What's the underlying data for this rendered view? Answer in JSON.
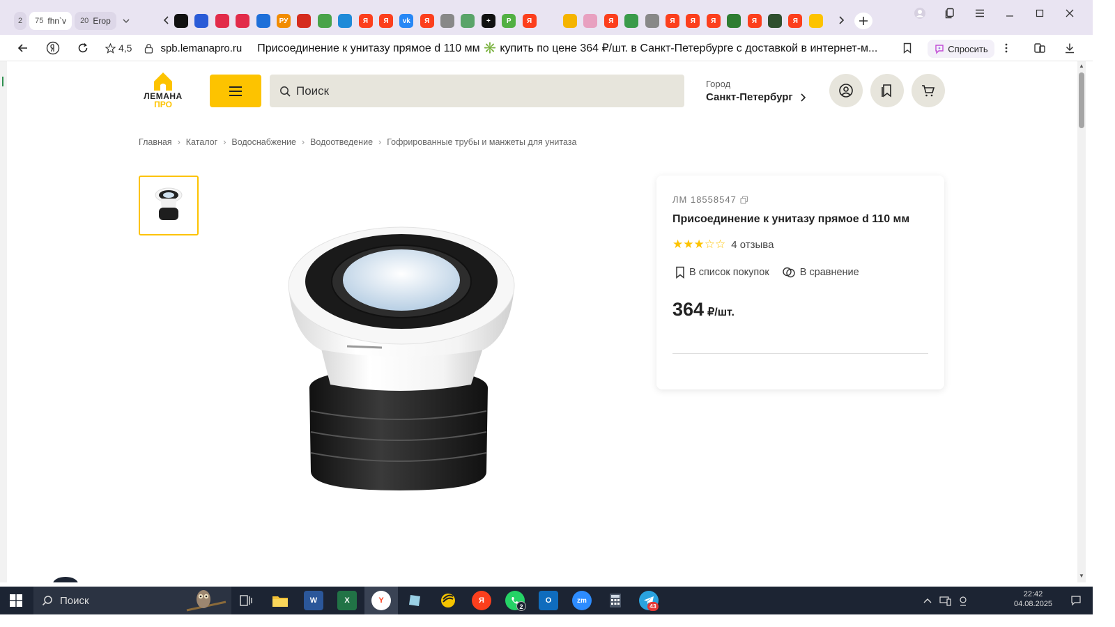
{
  "browser": {
    "tabs": [
      {
        "count": "2",
        "label": ""
      },
      {
        "count": "75",
        "label": "fhn`v"
      },
      {
        "count": "20",
        "label": "Егор"
      }
    ],
    "address": {
      "rating": "4,5",
      "domain": "spb.lemanapro.ru",
      "title": "Присоединение к унитазу прямое d 110 мм ✳️ купить по цене 364 ₽/шт. в Санкт-Петербурге с доставкой в интернет-м..."
    },
    "ask_label": "Спросить",
    "favicons": [
      {
        "icon": "panda-icon",
        "color": "#111111",
        "text": ""
      },
      {
        "icon": "ozon-icon",
        "color": "#2a5bd7",
        "text": ""
      },
      {
        "icon": "ring-icon",
        "color": "#e22b4a",
        "text": ""
      },
      {
        "icon": "ring-icon",
        "color": "#e22b4a",
        "text": ""
      },
      {
        "icon": "shield-icon",
        "color": "#1e6fd9",
        "text": ""
      },
      {
        "icon": "ru-icon",
        "color": "#f28c00",
        "text": "РУ"
      },
      {
        "icon": "flag-icon",
        "color": "#d52b1e",
        "text": ""
      },
      {
        "icon": "puzzle-icon",
        "color": "#4aa34a",
        "text": ""
      },
      {
        "icon": "cube-icon",
        "color": "#1f8ad8",
        "text": ""
      },
      {
        "icon": "yandex-icon",
        "color": "#fc3f1d",
        "text": "Я"
      },
      {
        "icon": "yandex-icon",
        "color": "#fc3f1d",
        "text": "Я"
      },
      {
        "icon": "vk-icon",
        "color": "#2787f5",
        "text": "vk"
      },
      {
        "icon": "yandex-icon",
        "color": "#fc3f1d",
        "text": "Я"
      },
      {
        "icon": "document-icon",
        "color": "#888888",
        "text": ""
      },
      {
        "icon": "green-circle-icon",
        "color": "#5aa469",
        "text": ""
      },
      {
        "icon": "plus-black-icon",
        "color": "#111111",
        "text": "+"
      },
      {
        "icon": "green-p-icon",
        "color": "#52b043",
        "text": "P"
      },
      {
        "icon": "yandex-icon",
        "color": "#fc3f1d",
        "text": "Я"
      }
    ],
    "favicons_right": [
      {
        "icon": "mountain-icon",
        "color": "#f5b400",
        "text": ""
      },
      {
        "icon": "crown-icon",
        "color": "#e8a0c0",
        "text": ""
      },
      {
        "icon": "yandex-icon",
        "color": "#fc3f1d",
        "text": "Я"
      },
      {
        "icon": "house-green-icon",
        "color": "#3a9b4a",
        "text": ""
      },
      {
        "icon": "document-icon",
        "color": "#888888",
        "text": ""
      },
      {
        "icon": "yandex-icon",
        "color": "#fc3f1d",
        "text": "Я"
      },
      {
        "icon": "yandex-icon",
        "color": "#fc3f1d",
        "text": "Я"
      },
      {
        "icon": "yandex-icon",
        "color": "#fc3f1d",
        "text": "Я"
      },
      {
        "icon": "tree-icon",
        "color": "#2e7d32",
        "text": ""
      },
      {
        "icon": "yandex-icon",
        "color": "#fc3f1d",
        "text": "Я"
      },
      {
        "icon": "virus-icon",
        "color": "#2f4f2f",
        "text": ""
      },
      {
        "icon": "yandex-icon",
        "color": "#fc3f1d",
        "text": "Я"
      },
      {
        "icon": "lemana-icon",
        "color": "#fdc300",
        "text": ""
      }
    ]
  },
  "site": {
    "logo_line1": "ЛЕМАНА",
    "logo_line2": "ПРО",
    "search_placeholder": "Поиск",
    "city_label": "Город",
    "city_name": "Санкт-Петербург",
    "accent": "#fdc300"
  },
  "breadcrumb": [
    "Главная",
    "Каталог",
    "Водоснабжение",
    "Водоотведение",
    "Гофрированные трубы и манжеты для унитаза"
  ],
  "product": {
    "sku": "ЛМ 18558547",
    "title": "Присоединение к унитазу прямое d 110 мм",
    "rating": 3,
    "rating_max": 5,
    "reviews": "4 отзыва",
    "action_list": "В список покупок",
    "action_compare": "В сравнение",
    "price": "364",
    "price_unit": "₽/шт."
  },
  "taskbar": {
    "search_label": "Поиск",
    "whatsapp_badge": "2",
    "telegram_badge": "43",
    "time": "22:42",
    "date": "04.08.2025"
  }
}
